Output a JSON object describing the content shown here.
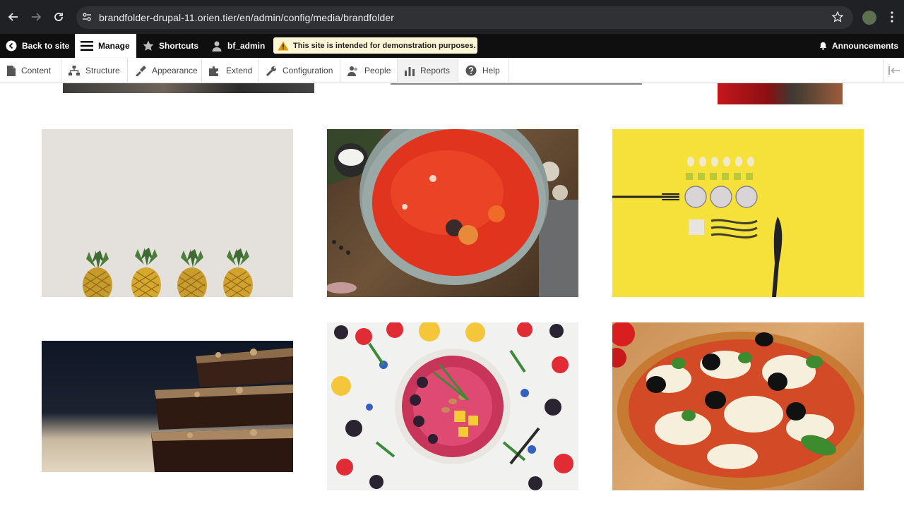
{
  "browser": {
    "url": "brandfolder-drupal-11.orien.tier/en/admin/config/media/brandfolder"
  },
  "toolbar": {
    "back_to_site": "Back to site",
    "manage": "Manage",
    "shortcuts": "Shortcuts",
    "user": "bf_admin",
    "demo_notice": "This site is intended for demonstration purposes.",
    "announcements": "Announcements"
  },
  "tray": {
    "items": [
      "Content",
      "Structure",
      "Appearance",
      "Extend",
      "Configuration",
      "People",
      "Reports",
      "Help"
    ]
  },
  "gallery": {
    "images": [
      "pineapples-icon",
      "tomato-soup-icon",
      "yellow-flatlay-icon",
      "brownies-icon",
      "fruit-bowl-icon",
      "pizza-icon"
    ]
  },
  "colors": {
    "toolbar_bg": "#0f0f0f",
    "browser_bg": "#202124",
    "notice_bg": "#fff6d6"
  }
}
